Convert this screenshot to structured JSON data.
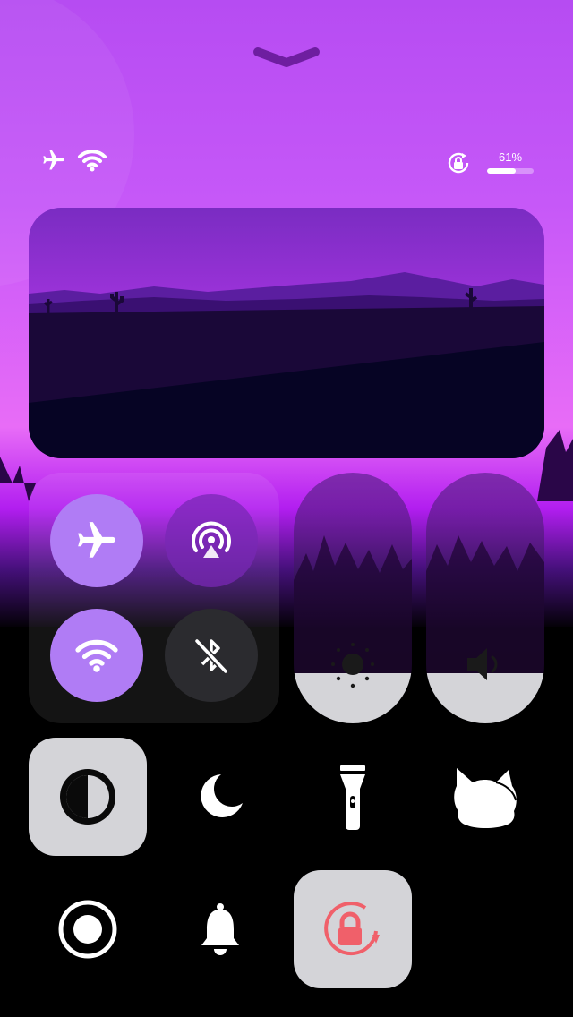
{
  "status": {
    "battery_percent_label": "61%",
    "battery_level": 0.61,
    "icons": [
      "airplane-icon",
      "wifi-icon",
      "orientation-lock-icon"
    ]
  },
  "connectivity": {
    "airplane": {
      "icon": "airplane-icon",
      "active": true
    },
    "airdrop": {
      "icon": "airdrop-icon",
      "active": true
    },
    "wifi": {
      "icon": "wifi-icon",
      "active": true
    },
    "bluetooth": {
      "icon": "bluetooth-off-icon",
      "active": false
    }
  },
  "sliders": {
    "brightness": {
      "icon": "sun-icon",
      "level": 0.2
    },
    "volume": {
      "icon": "speaker-icon",
      "level": 0.2
    }
  },
  "tiles": {
    "dark_mode": {
      "icon": "dark-mode-icon",
      "active": true
    },
    "do_not_disturb": {
      "icon": "moon-icon",
      "active": false
    },
    "flashlight": {
      "icon": "flashlight-icon",
      "active": false
    },
    "pet": {
      "icon": "cat-icon",
      "active": false
    },
    "screen_record": {
      "icon": "record-icon",
      "active": false
    },
    "notifications": {
      "icon": "bell-icon",
      "active": false
    },
    "orientation_lock": {
      "icon": "orientation-lock-icon",
      "active": true
    }
  },
  "colors": {
    "accent_purple": "#b07cf5",
    "dark_button": "#2b2b2f",
    "light_tile": "#d4d4d8",
    "lock_red": "#f0606a"
  }
}
